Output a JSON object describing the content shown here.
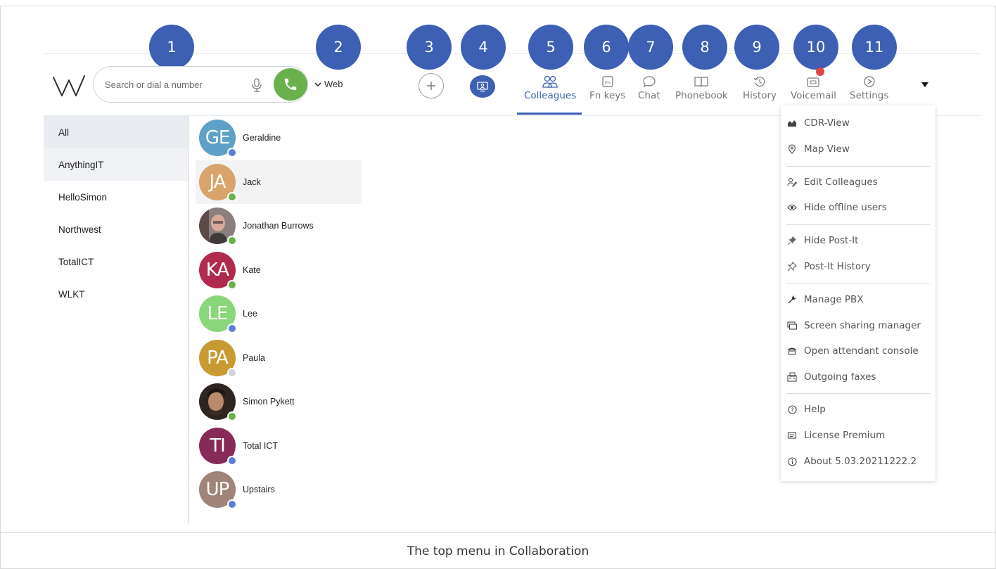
{
  "search": {
    "placeholder": "Search or dial a number"
  },
  "web_label": "Web",
  "numbers": [
    "1",
    "2",
    "3",
    "4",
    "5",
    "6",
    "7",
    "8",
    "9",
    "10",
    "11"
  ],
  "tabs": [
    {
      "label": "Colleagues",
      "icon": "people-icon"
    },
    {
      "label": "Fn keys",
      "icon": "fn-key-icon"
    },
    {
      "label": "Chat",
      "icon": "chat-bubble-icon"
    },
    {
      "label": "Phonebook",
      "icon": "book-icon"
    },
    {
      "label": "History",
      "icon": "history-icon"
    },
    {
      "label": "Voicemail",
      "icon": "voicemail-icon"
    },
    {
      "label": "Settings",
      "icon": "settings-icon"
    }
  ],
  "active_tab": "Colleagues",
  "sidebar": {
    "items": [
      {
        "label": "All"
      },
      {
        "label": "AnythingIT"
      },
      {
        "label": "HelloSimon"
      },
      {
        "label": "Northwest"
      },
      {
        "label": "TotalICT"
      },
      {
        "label": "WLKT"
      }
    ],
    "selected": "All"
  },
  "contacts": [
    {
      "initials": "GE",
      "name": "Geraldine",
      "avatar_color": "#5fa0c8",
      "status_color": "#5b7fd6"
    },
    {
      "initials": "JA",
      "name": "Jack",
      "avatar_color": "#d8a46c",
      "status_color": "#6ab04c"
    },
    {
      "initials": "",
      "name": "Jonathan Burrows",
      "avatar_color": "#7a6a66",
      "status_color": "#6ab04c",
      "photo": true
    },
    {
      "initials": "KA",
      "name": "Kate",
      "avatar_color": "#b02a4e",
      "status_color": "#6ab04c"
    },
    {
      "initials": "LE",
      "name": "Lee",
      "avatar_color": "#8ad67a",
      "status_color": "#5b7fd6"
    },
    {
      "initials": "PA",
      "name": "Paula",
      "avatar_color": "#c89a32",
      "status_color": "#d0d4da"
    },
    {
      "initials": "",
      "name": "Simon Pykett",
      "avatar_color": "#4a3c35",
      "status_color": "#6ab04c",
      "photo": true
    },
    {
      "initials": "TI",
      "name": "Total ICT",
      "avatar_color": "#862b58",
      "status_color": "#5b7fd6"
    },
    {
      "initials": "UP",
      "name": "Upstairs",
      "avatar_color": "#a08478",
      "status_color": "#5b7fd6"
    }
  ],
  "menu": {
    "items": [
      {
        "label": "CDR-View",
        "icon": "chart-area-icon"
      },
      {
        "label": "Map View",
        "icon": "map-pin-icon"
      },
      {
        "label": "Edit Colleagues",
        "icon": "edit-user-icon"
      },
      {
        "label": "Hide offline users",
        "icon": "eye-icon"
      },
      {
        "label": "Hide Post-It",
        "icon": "pin-icon"
      },
      {
        "label": "Post-It History",
        "icon": "pin-outline-icon"
      },
      {
        "label": "Manage PBX",
        "icon": "wrench-icon"
      },
      {
        "label": "Screen sharing manager",
        "icon": "screen-share-icon"
      },
      {
        "label": "Open attendant console",
        "icon": "phone-console-icon"
      },
      {
        "label": "Outgoing faxes",
        "icon": "fax-icon"
      },
      {
        "label": "Help",
        "icon": "help-icon"
      },
      {
        "label": "License Premium",
        "icon": "license-icon"
      },
      {
        "label": "About 5.03.20211222.2",
        "icon": "info-icon"
      }
    ]
  },
  "caption": "The top menu in Collaboration",
  "colors": {
    "accent": "#3d5fb4",
    "call_green": "#6ab04c",
    "voicemail_badge": "#e04646"
  }
}
